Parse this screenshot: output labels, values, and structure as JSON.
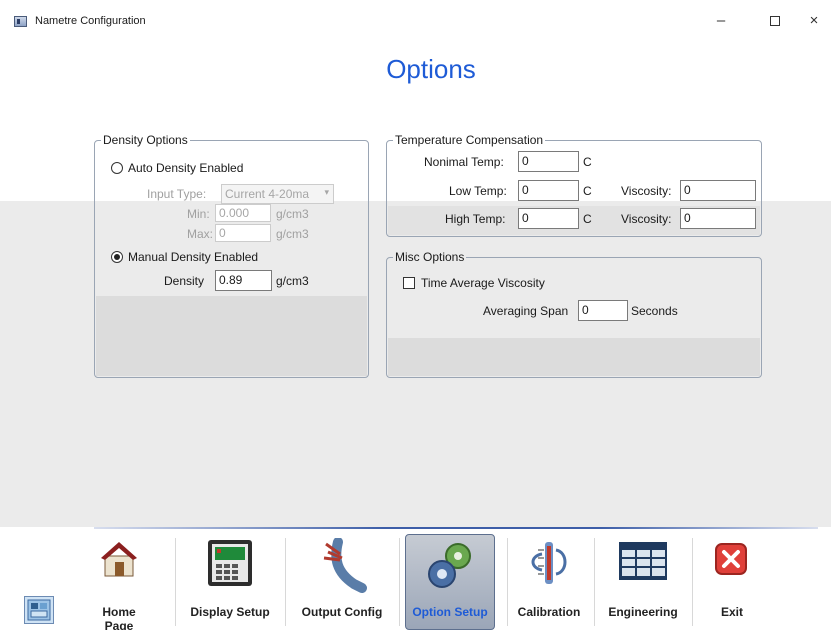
{
  "window": {
    "title": "Nametre Configuration",
    "minimize": "–",
    "close": "×"
  },
  "page": {
    "title": "Options"
  },
  "density_options": {
    "legend": "Density Options",
    "auto_label": "Auto Density Enabled",
    "auto_selected": false,
    "input_type_label": "Input Type:",
    "input_type_value": "Current 4-20ma",
    "min_label": "Min:",
    "min_value": "0.000",
    "min_unit": "g/cm3",
    "max_label": "Max:",
    "max_value": "0",
    "max_unit": "g/cm3",
    "manual_label": "Manual Density Enabled",
    "manual_selected": true,
    "density_label": "Density",
    "density_value": "0.89",
    "density_unit": "g/cm3"
  },
  "temperature_compensation": {
    "legend": "Temperature Compensation",
    "nominal_label": "Nonimal Temp:",
    "nominal_value": "0",
    "nominal_unit": "C",
    "low_label": "Low Temp:",
    "low_value": "0",
    "low_unit": "C",
    "low_visc_label": "Viscosity:",
    "low_visc_value": "0",
    "high_label": "High Temp:",
    "high_value": "0",
    "high_unit": "C",
    "high_visc_label": "Viscosity:",
    "high_visc_value": "0"
  },
  "misc_options": {
    "legend": "Misc Options",
    "time_avg_label": "Time Average Viscosity",
    "time_avg_checked": false,
    "span_label": "Averaging Span",
    "span_value": "0",
    "span_unit": "Seconds"
  },
  "nav": {
    "items": [
      {
        "label": "Home Page",
        "icon": "home-icon"
      },
      {
        "label": "Display Setup",
        "icon": "display-icon"
      },
      {
        "label": "Output Config",
        "icon": "cable-icon"
      },
      {
        "label": "Option Setup",
        "icon": "gears-icon",
        "active": true
      },
      {
        "label": "Calibration",
        "icon": "calibration-icon"
      },
      {
        "label": "Engineering",
        "icon": "table-icon"
      },
      {
        "label": "Exit",
        "icon": "exit-icon"
      }
    ]
  },
  "colors": {
    "accent": "#1e5bd6",
    "exit_red": "#e0403a",
    "active_tab": "#9ba6b8"
  }
}
